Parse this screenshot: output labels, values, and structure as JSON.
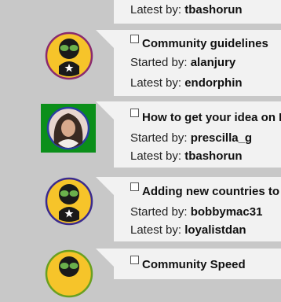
{
  "labels": {
    "started_by": "Started by:",
    "latest_by": "Latest by:"
  },
  "partial_top": {
    "latest_by_user": "tbashorun"
  },
  "topics": [
    {
      "title": "Community guidelines",
      "started_by": "alanjury",
      "latest_by": "endorphin",
      "avatar": "ninja-icon",
      "ring_color": "#8a2a6e"
    },
    {
      "title": "How to get your idea on La",
      "started_by": "prescilla_g",
      "latest_by": "tbashorun",
      "avatar": "photo",
      "ring_color": "#2a3fa0"
    },
    {
      "title": "Adding new countries to re",
      "started_by": "bobbymac31",
      "latest_by": "loyalistdan",
      "avatar": "ninja-icon",
      "ring_color": "#3a2a8e"
    },
    {
      "title": "Community Speed",
      "avatar": "ninja-icon",
      "ring_color": "#6aa020"
    }
  ]
}
